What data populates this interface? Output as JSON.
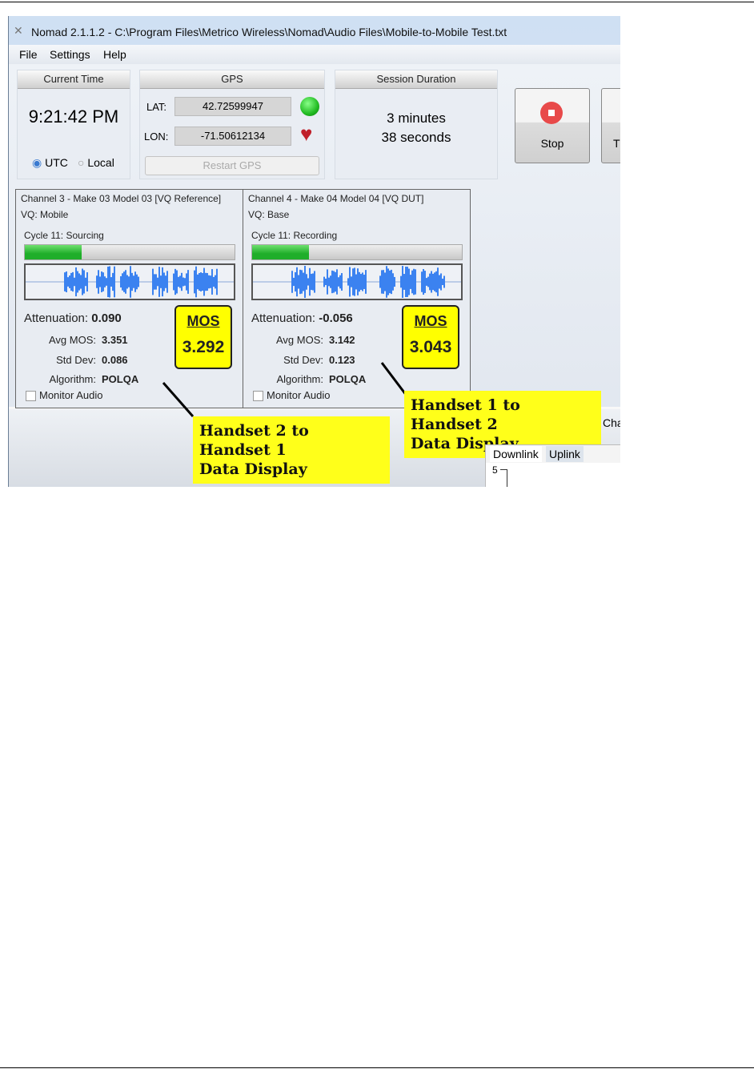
{
  "window": {
    "title": "Nomad 2.1.1.2 - C:\\Program Files\\Metrico Wireless\\Nomad\\Audio Files\\Mobile-to-Mobile Test.txt"
  },
  "menu": [
    "File",
    "Settings",
    "Help"
  ],
  "current_time": {
    "header": "Current Time",
    "value": "9:21:42 PM",
    "utc": "UTC",
    "local": "Local",
    "selected": "UTC"
  },
  "gps": {
    "header": "GPS",
    "lat_label": "LAT:",
    "lat": "42.72599947",
    "lon_label": "LON:",
    "lon": "-71.50612134",
    "restart": "Restart GPS",
    "status_color": "#22bb22",
    "heart_color": "#c0202a"
  },
  "session": {
    "header": "Session Duration",
    "line1": "3 minutes",
    "line2": "38 seconds"
  },
  "buttons": {
    "stop": "Stop",
    "next_partial": "T"
  },
  "channels": [
    {
      "title": "Channel 3 - Make 03 Model 03 [VQ Reference]",
      "vq": "VQ: Mobile",
      "cycle": "Cycle 11: Sourcing",
      "progress": 0.27,
      "att_label": "Attenuation:",
      "att": "0.090",
      "avg_label": "Avg MOS:",
      "avg": "3.351",
      "std_label": "Std Dev:",
      "std": "0.086",
      "alg_label": "Algorithm:",
      "alg": "POLQA",
      "monitor": "Monitor Audio",
      "mos_label": "MOS",
      "mos": "3.292"
    },
    {
      "title": "Channel 4 - Make 04 Model 04 [VQ DUT]",
      "vq": "VQ: Base",
      "cycle": "Cycle 11: Recording",
      "progress": 0.27,
      "att_label": "Attenuation:",
      "att": "-0.056",
      "avg_label": "Avg MOS:",
      "avg": "3.142",
      "std_label": "Std Dev:",
      "std": "0.123",
      "alg_label": "Algorithm:",
      "alg": "POLQA",
      "monitor": "Monitor Audio",
      "mos_label": "MOS",
      "mos": "3.043"
    }
  ],
  "callouts": {
    "left_line1": "Handset 2 to Handset 1",
    "left_line2": "Data Display",
    "right_line1": "Handset 1 to Handset 2",
    "right_line2": "Data Display"
  },
  "lower": {
    "tab_partial": "Cha",
    "tabs": [
      "Downlink",
      "Uplink"
    ],
    "axis_tick": "5"
  }
}
